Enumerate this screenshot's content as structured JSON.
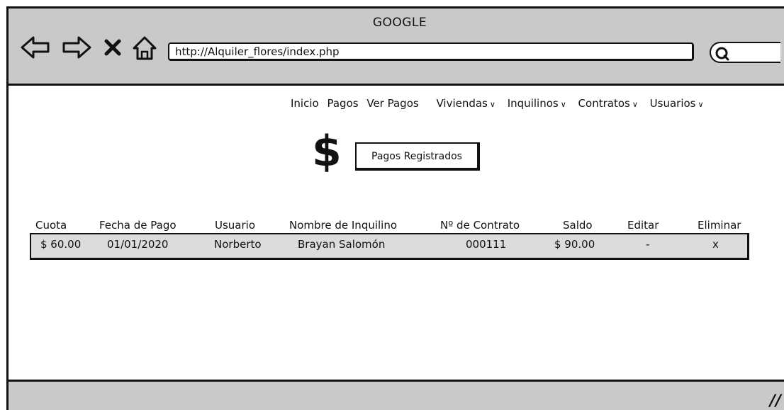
{
  "window": {
    "title": "GOOGLE"
  },
  "browser": {
    "url": "http://Alquiler_flores/index.php",
    "icons": [
      "back-arrow-icon",
      "forward-arrow-icon",
      "close-x-icon",
      "home-icon",
      "search-icon"
    ]
  },
  "nav": {
    "items": [
      {
        "label": "Inicio",
        "dropdown": false
      },
      {
        "label": "Pagos",
        "dropdown": false
      },
      {
        "label": "Ver Pagos",
        "dropdown": false
      },
      {
        "label": "Viviendas",
        "dropdown": true
      },
      {
        "label": "Inquilinos",
        "dropdown": true
      },
      {
        "label": "Contratos",
        "dropdown": true
      },
      {
        "label": "Usuarios",
        "dropdown": true
      }
    ]
  },
  "page": {
    "currency_symbol": "$",
    "button_label": "Pagos Registrados"
  },
  "table": {
    "columns": [
      "Cuota",
      "Fecha de Pago",
      "Usuario",
      "Nombre de Inquilino",
      "Nº de Contrato",
      "Saldo",
      "Editar",
      "Eliminar"
    ],
    "rows": [
      [
        "$ 60.00",
        "01/01/2020",
        "Norberto",
        "Brayan Salomón",
        "000111",
        "$ 90.00",
        "-",
        "x"
      ]
    ]
  }
}
